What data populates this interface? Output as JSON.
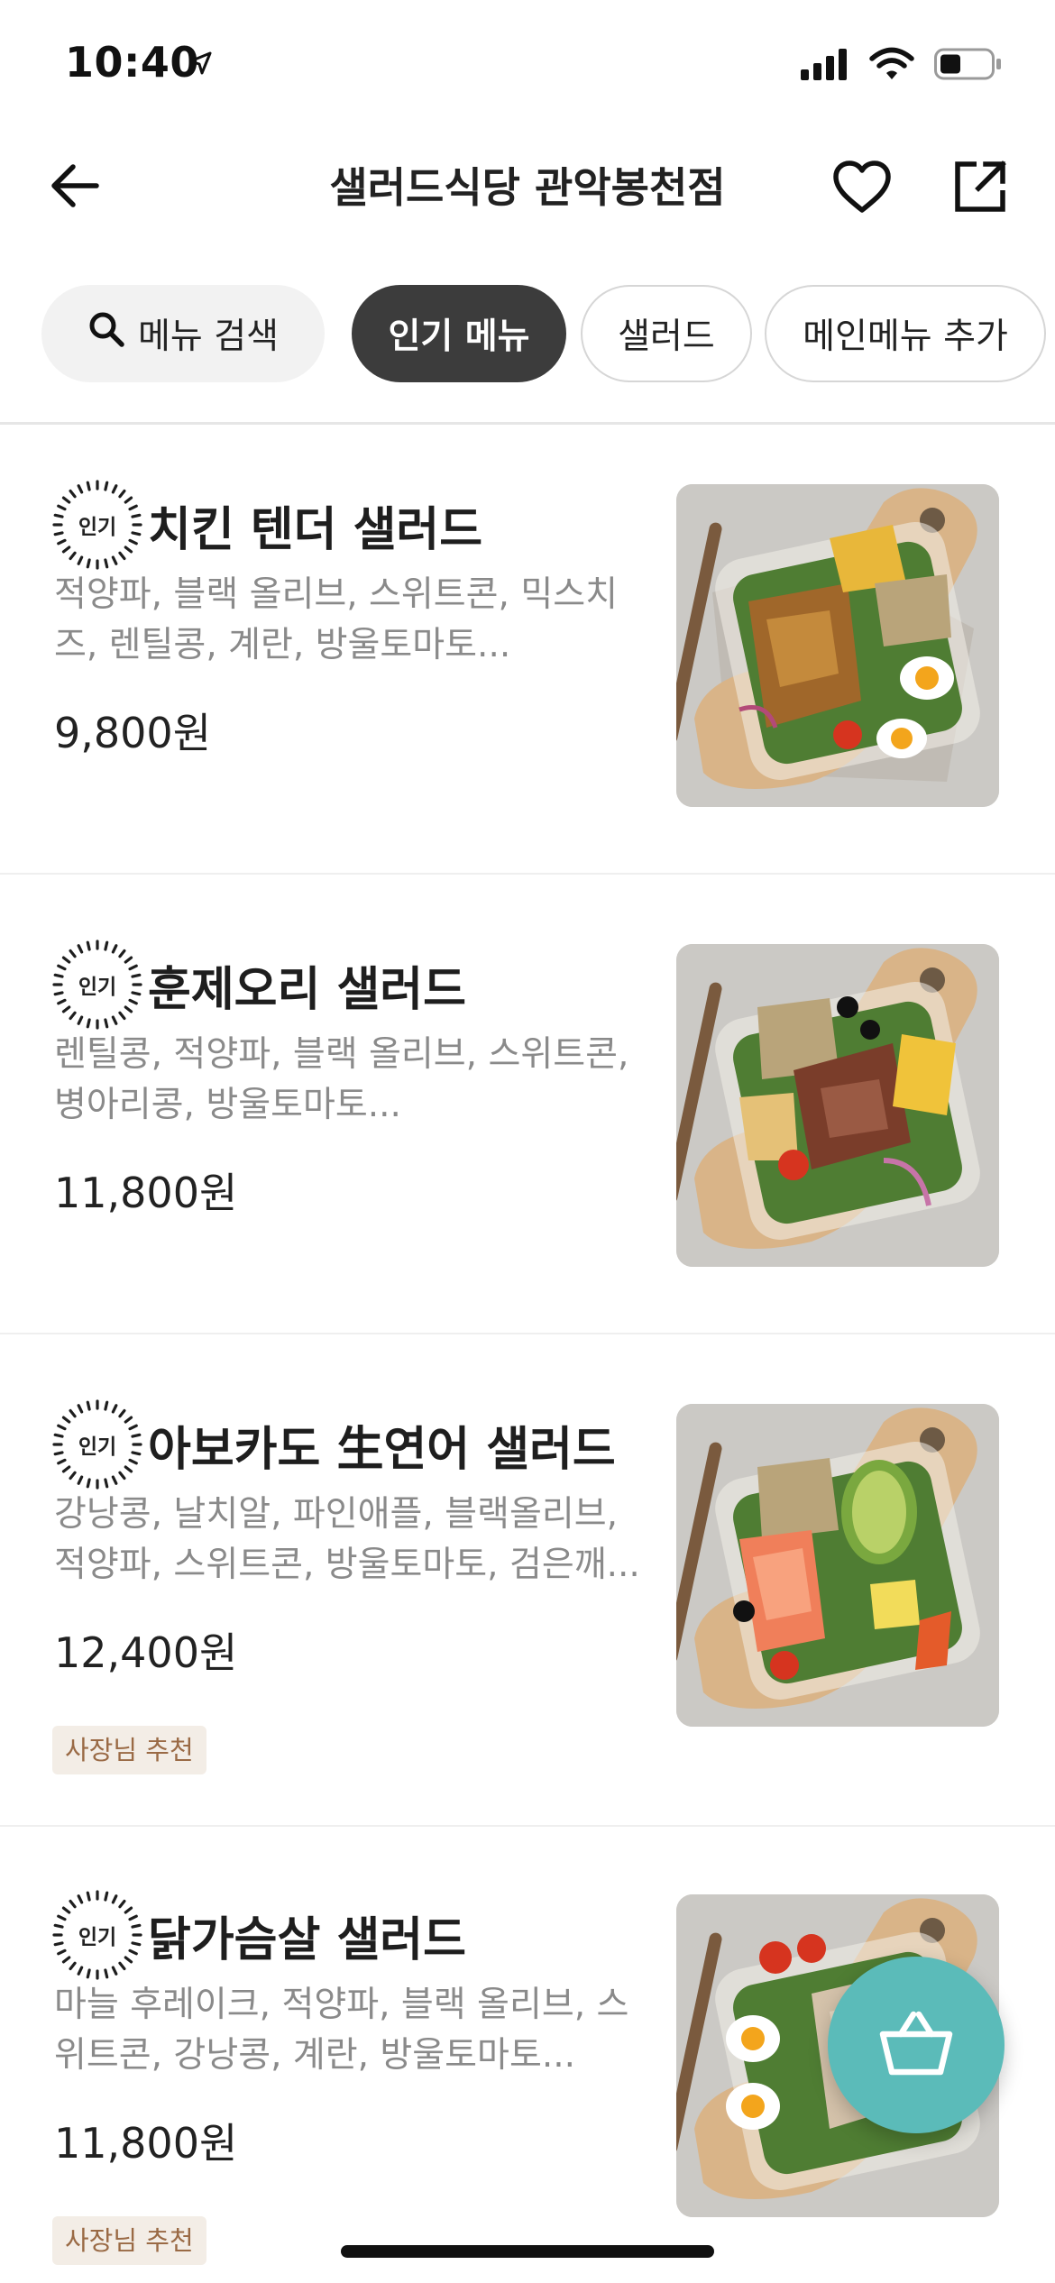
{
  "status_bar": {
    "time": "10:40",
    "icons": [
      "location-arrow-icon",
      "signal-icon",
      "wifi-icon",
      "battery-icon"
    ]
  },
  "nav": {
    "title": "샐러드식당 관악봉천점",
    "icons": [
      "back-arrow-icon",
      "heart-icon",
      "share-icon"
    ]
  },
  "chips": {
    "search_label": "메뉴 검색",
    "items": [
      "인기 메뉴",
      "샐러드",
      "메인메뉴 추가"
    ],
    "selected": "인기 메뉴"
  },
  "badge_label": "인기",
  "menu": [
    {
      "name": "치킨 텐더 샐러드",
      "desc": "적양파, 블랙 올리브, 스위트콘, 믹스치즈, 렌틸콩, 계란, 방울토마토...",
      "price": "9,800원",
      "tag": ""
    },
    {
      "name": "훈제오리 샐러드",
      "desc": "렌틸콩, 적양파, 블랙 올리브, 스위트콘, 병아리콩, 방울토마토...",
      "price": "11,800원",
      "tag": ""
    },
    {
      "name": "아보카도 生연어 샐러드",
      "desc": "강낭콩, 날치알, 파인애플, 블랙올리브, 적양파, 스위트콘, 방울토마토, 검은깨...",
      "price": "12,400원",
      "tag": "사장님 추천"
    },
    {
      "name": "닭가슴살 샐러드",
      "desc": "마늘 후레이크, 적양파, 블랙 올리브, 스위트콘, 강낭콩, 계란, 방울토마토...",
      "price": "11,800원",
      "tag": "사장님 추천"
    }
  ],
  "colors": {
    "accent": "#5bbbb9",
    "chip_selected": "#3c3c3c",
    "tag_bg": "#f3ede6",
    "tag_text": "#9a6a45"
  },
  "fab_icon": "basket-icon"
}
